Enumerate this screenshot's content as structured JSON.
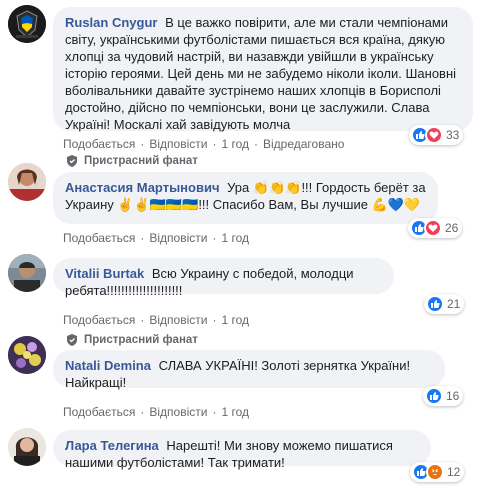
{
  "fan_badge_label": "Пристрасний фанат",
  "actions": {
    "like": "Подобається",
    "reply": "Відповісти",
    "separator": "·",
    "edited": "Відредаговано"
  },
  "comments": [
    {
      "author": "Ruslan Cnygur",
      "text": "В це важко повірити, але ми стали чемпіонами світу, українськими футболістами пишається вся країна, дякую хлопці за чудовий настрій, ви назавжди увійшли в українську історію героями. Цей день ми не забудемо ніколи іколи. Шановні вболівальники давайте зустрінемо наших хлопців в Борисполі достойно, дійсно по чемпіонськи, вони це заслужили. Слава Україні! Москалі хай завідують молча",
      "time": "1 год",
      "reaction_count": "33",
      "reactions": [
        "like-icon",
        "love-icon"
      ]
    },
    {
      "author": "Анастасия Мартынович",
      "text_part1": "Ура ",
      "emoji1": "👏👏👏",
      "text_part2": "!!! Гордость берёт за Украину ",
      "emoji2": "✌️✌️",
      "flags": "🇺🇦🇺🇦🇺🇦",
      "text_part3": "!!! Спасибо Вам, Вы лучшие ",
      "emoji3": "💪💙💛",
      "time": "1 год",
      "reaction_count": "26",
      "reactions": [
        "like-icon",
        "love-icon"
      ]
    },
    {
      "author": "Vitalii Burtak",
      "text": "Всю Украину с победой, молодци ребята!!!!!!!!!!!!!!!!!!!!!",
      "time": "1 год",
      "reaction_count": "21",
      "reactions": [
        "like-icon"
      ]
    },
    {
      "author": "Natali Demina",
      "text": "СЛАВА УКРАЇНІ! Золоті зернятка України! Найкращі!",
      "time": "1 год",
      "reaction_count": "16",
      "reactions": [
        "like-icon"
      ]
    },
    {
      "author": "Лара Телегина",
      "text": "Нарешті! Ми знову можемо пишатися нашими футболістами! Так тримати!",
      "time": "1 год",
      "reaction_count": "12",
      "reactions": [
        "like-icon",
        "angry-icon"
      ]
    }
  ],
  "colors": {
    "link": "#385898",
    "bubble": "#f0f2f5",
    "meta": "#65676b",
    "like": "#1877f2",
    "love": "#f33e58",
    "angry": "#e9710f"
  }
}
